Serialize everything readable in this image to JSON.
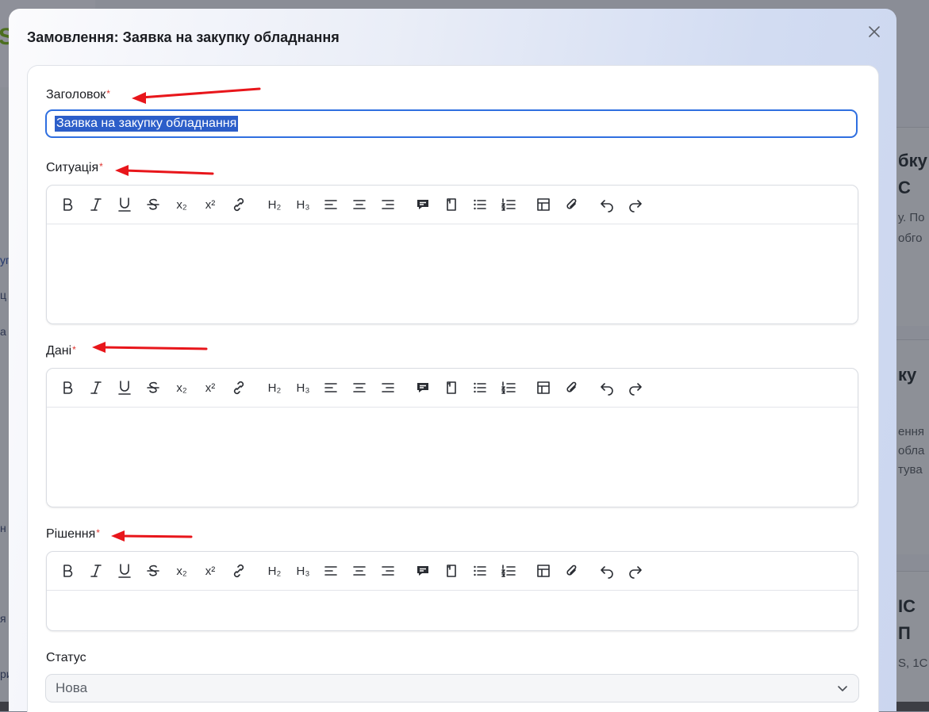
{
  "background": {
    "logo_text": "S",
    "logo_small": "",
    "left_fragments": [
      "уп",
      "ц",
      "а",
      "н",
      "я",
      "ри"
    ],
    "right_cards": [
      {
        "title_lines": [
          "бку",
          "С"
        ],
        "desc_lines": [
          "у. По",
          "обго"
        ]
      },
      {
        "title_lines": [
          "ку"
        ],
        "desc_lines": [
          "ення",
          "обла",
          "тува"
        ]
      },
      {
        "title_lines": [
          "ІС",
          "П"
        ],
        "desc_lines": [
          "S, 1C"
        ]
      }
    ]
  },
  "modal": {
    "title": "Замовлення: Заявка на закупку обладнання",
    "close_icon": "close-icon"
  },
  "fields": {
    "title": {
      "label": "Заголовок",
      "required_mark": "*",
      "value": "Заявка на закупку обладнання"
    },
    "situation": {
      "label": "Ситуація",
      "required_mark": "*"
    },
    "data": {
      "label": "Дані",
      "required_mark": "*"
    },
    "solution": {
      "label": "Рішення",
      "required_mark": "*"
    },
    "status": {
      "label": "Статус",
      "value": "Нова"
    }
  },
  "toolbar_icons": [
    "bold-icon",
    "italic-icon",
    "underline-icon",
    "strikethrough-icon",
    "subscript-icon",
    "superscript-icon",
    "link-icon",
    "heading2-icon",
    "heading3-icon",
    "align-left-icon",
    "align-center-icon",
    "align-right-icon",
    "comment-icon",
    "note-icon",
    "bullet-list-icon",
    "numbered-list-icon",
    "table-icon",
    "attachment-icon",
    "undo-icon",
    "redo-icon"
  ],
  "toolbar_text": {
    "subscript": "x₂",
    "superscript": "x²",
    "h2": "H₂",
    "h3": "H₃"
  },
  "colors": {
    "accent": "#2f6fe0",
    "required": "#e0342f",
    "arrow": "#e8161b"
  }
}
